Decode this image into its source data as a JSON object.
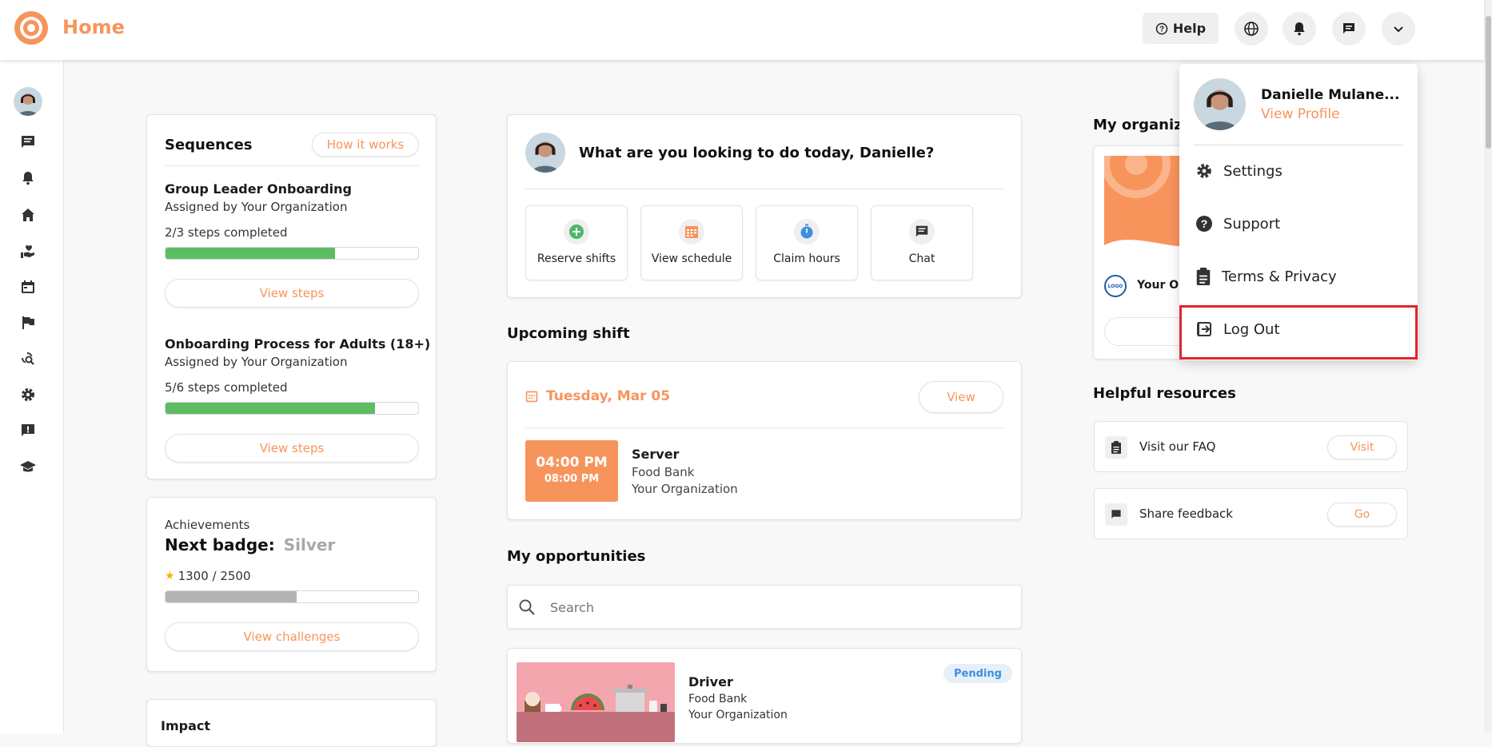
{
  "header": {
    "title": "Home",
    "help_label": "Help"
  },
  "sequences": {
    "title": "Sequences",
    "how_it_works": "How it works",
    "items": [
      {
        "title": "Group Leader Onboarding",
        "assigned": "Assigned by Your Organization",
        "steps": "2/3 steps completed",
        "progress": 0.67,
        "button": "View steps"
      },
      {
        "title": "Onboarding Process for Adults (18+)",
        "assigned": "Assigned by Your Organization",
        "steps": "5/6 steps completed",
        "progress": 0.83,
        "button": "View steps"
      }
    ]
  },
  "achievements": {
    "title": "Achievements",
    "next_badge_label": "Next badge:",
    "next_badge_value": "Silver",
    "points": "1300 / 2500",
    "progress": 0.52,
    "button": "View challenges"
  },
  "impact": {
    "title": "Impact"
  },
  "prompt": {
    "question": "What are you looking to do today, Danielle?",
    "actions": [
      {
        "label": "Reserve shifts",
        "icon": "plus-circle-icon"
      },
      {
        "label": "View schedule",
        "icon": "calendar-grid-icon"
      },
      {
        "label": "Claim hours",
        "icon": "timer-icon"
      },
      {
        "label": "Chat",
        "icon": "chat-icon"
      }
    ]
  },
  "upcoming": {
    "heading": "Upcoming shift",
    "date": "Tuesday, Mar 05",
    "view_label": "View",
    "start_time": "04:00 PM",
    "end_time": "08:00 PM",
    "role": "Server",
    "location": "Food Bank",
    "org": "Your Organization"
  },
  "opportunities": {
    "heading": "My opportunities",
    "search_placeholder": "Search",
    "item": {
      "title": "Driver",
      "location": "Food Bank",
      "org": "Your Organization",
      "status": "Pending"
    }
  },
  "organizations": {
    "heading": "My organiza",
    "org_name": "Your Or",
    "logo_text": "LOGO"
  },
  "resources": {
    "heading": "Helpful resources",
    "items": [
      {
        "label": "Visit our FAQ",
        "button": "Visit"
      },
      {
        "label": "Share feedback",
        "button": "Go"
      }
    ]
  },
  "profile_menu": {
    "name": "Danielle Mulane...",
    "view_profile": "View Profile",
    "items": [
      "Settings",
      "Support",
      "Terms & Privacy",
      "Log Out"
    ]
  },
  "colors": {
    "accent": "#f7945c",
    "progress_green": "#5cbd63",
    "progress_gray": "#b3b3b3",
    "highlight_red": "#e3242b"
  }
}
